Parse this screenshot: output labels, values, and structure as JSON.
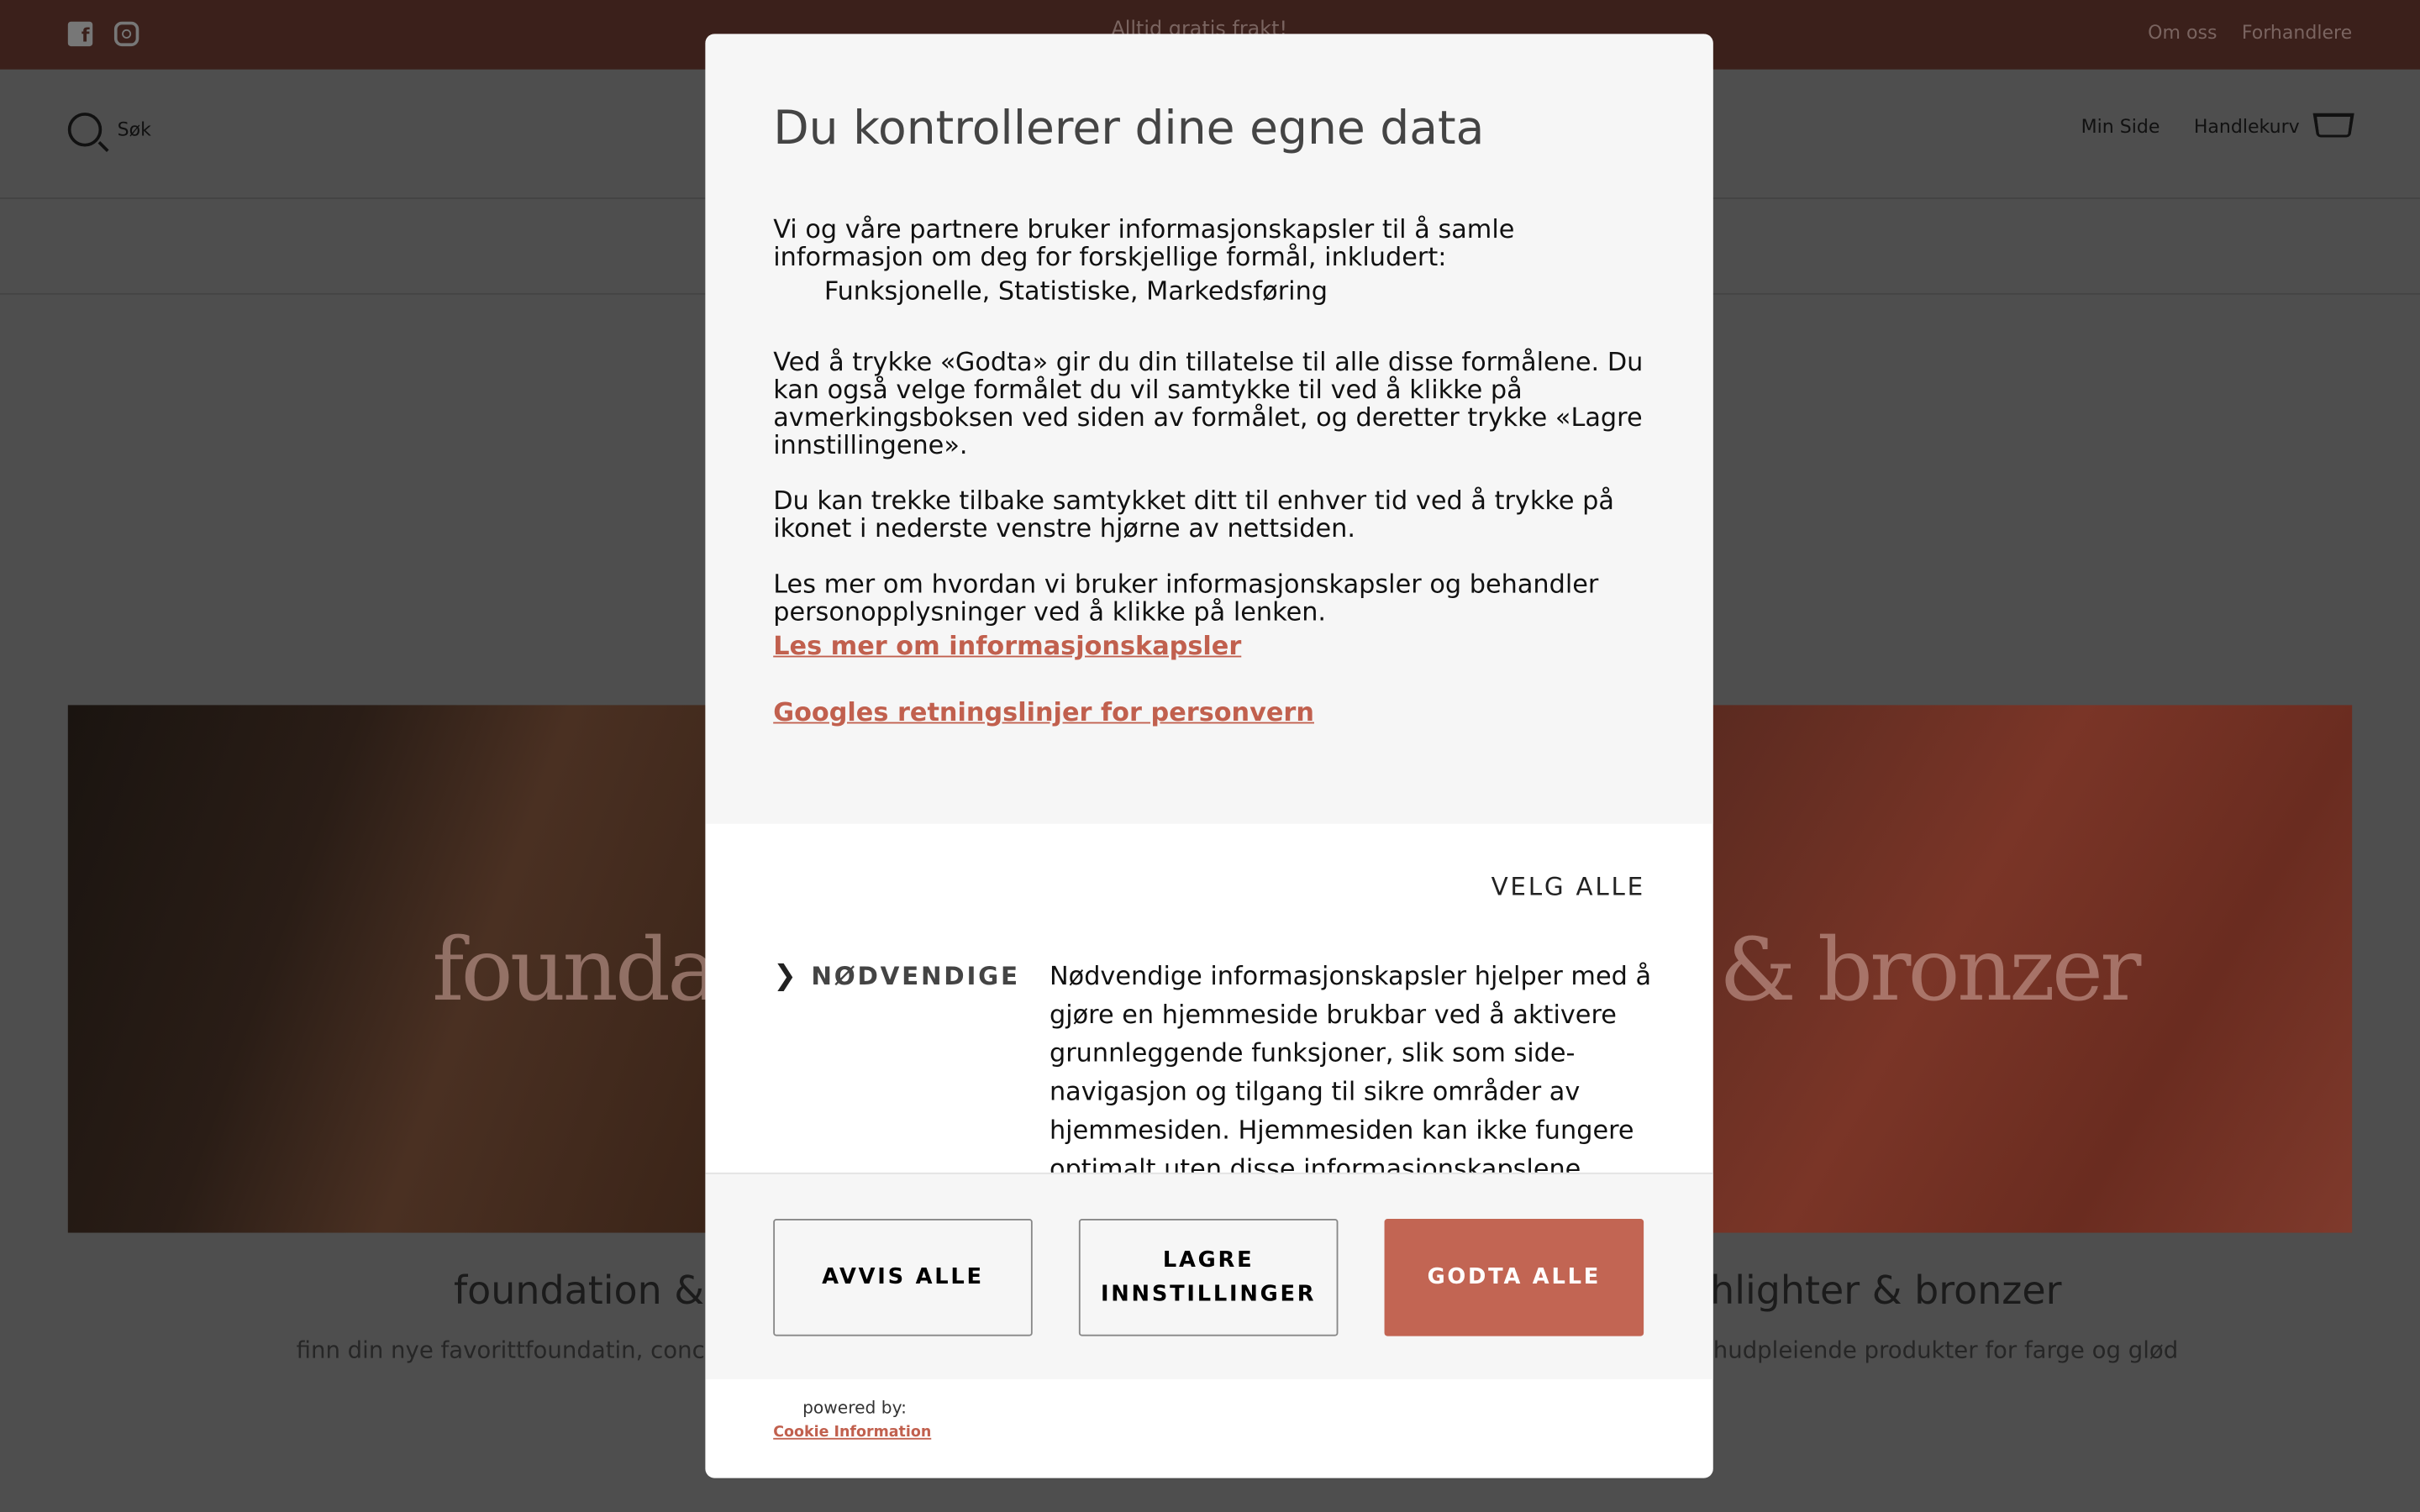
{
  "topbar": {
    "promo": "Alltid gratis frakt!",
    "links": [
      "Om oss",
      "Forhandlere"
    ],
    "social_icons": [
      "facebook-icon",
      "instagram-icon"
    ]
  },
  "header": {
    "search_label": "Søk",
    "my_page": "Min Side",
    "cart": "Handlekurv"
  },
  "cards": [
    {
      "overlay": "foundat",
      "title": "foundation &",
      "subtitle": "finn din nye favorittfoundatin, conc"
    },
    {
      "overlay": "& bronzer",
      "title": "hlighter & bronzer",
      "subtitle": "hudpleiende produkter for farge og glød"
    }
  ],
  "modal": {
    "title": "Du kontrollerer dine egne data",
    "intro": "Vi og våre partnere bruker informasjonskapsler til å samle informasjon om deg for forskjellige formål, inkludert:",
    "purposes": "Funksjonelle, Statistiske, Markedsføring",
    "p2": "Ved å trykke «Godta» gir du din tillatelse til alle disse formålene. Du kan også velge formålet du vil samtykke til ved å klikke på avmerkingsboksen ved siden av formålet, og deretter trykke «Lagre innstillingene».",
    "p3": "Du kan trekke tilbake samtykket ditt til enhver tid ved å trykke på ikonet i nederste venstre hjørne av nettsiden.",
    "p4": "Les mer om hvordan vi bruker informasjonskapsler og behandler personopplysninger ved å klikke på lenken.",
    "link1": "Les mer om informasjonskapsler",
    "link2": "Googles retningslinjer for personvern",
    "select_all": "VELG ALLE",
    "category": {
      "name": "NØDVENDIGE",
      "description": "Nødvendige informasjonskapsler hjelper med å gjøre en hjemmeside brukbar ved å aktivere grunnleggende funksjoner, slik som side-navigasjon og tilgang til sikre områder av hjemmesiden. Hjemmesiden kan ikke fungere optimalt uten disse informasjonskapslene."
    },
    "buttons": {
      "reject": "AVVIS ALLE",
      "save": "LAGRE INNSTILLINGER",
      "accept": "GODTA ALLE"
    },
    "powered_by": "powered by:",
    "provider": "Cookie Information"
  },
  "colors": {
    "accent": "#c26553",
    "topbar": "#3b201b",
    "overlay": "#4e4e4e"
  }
}
